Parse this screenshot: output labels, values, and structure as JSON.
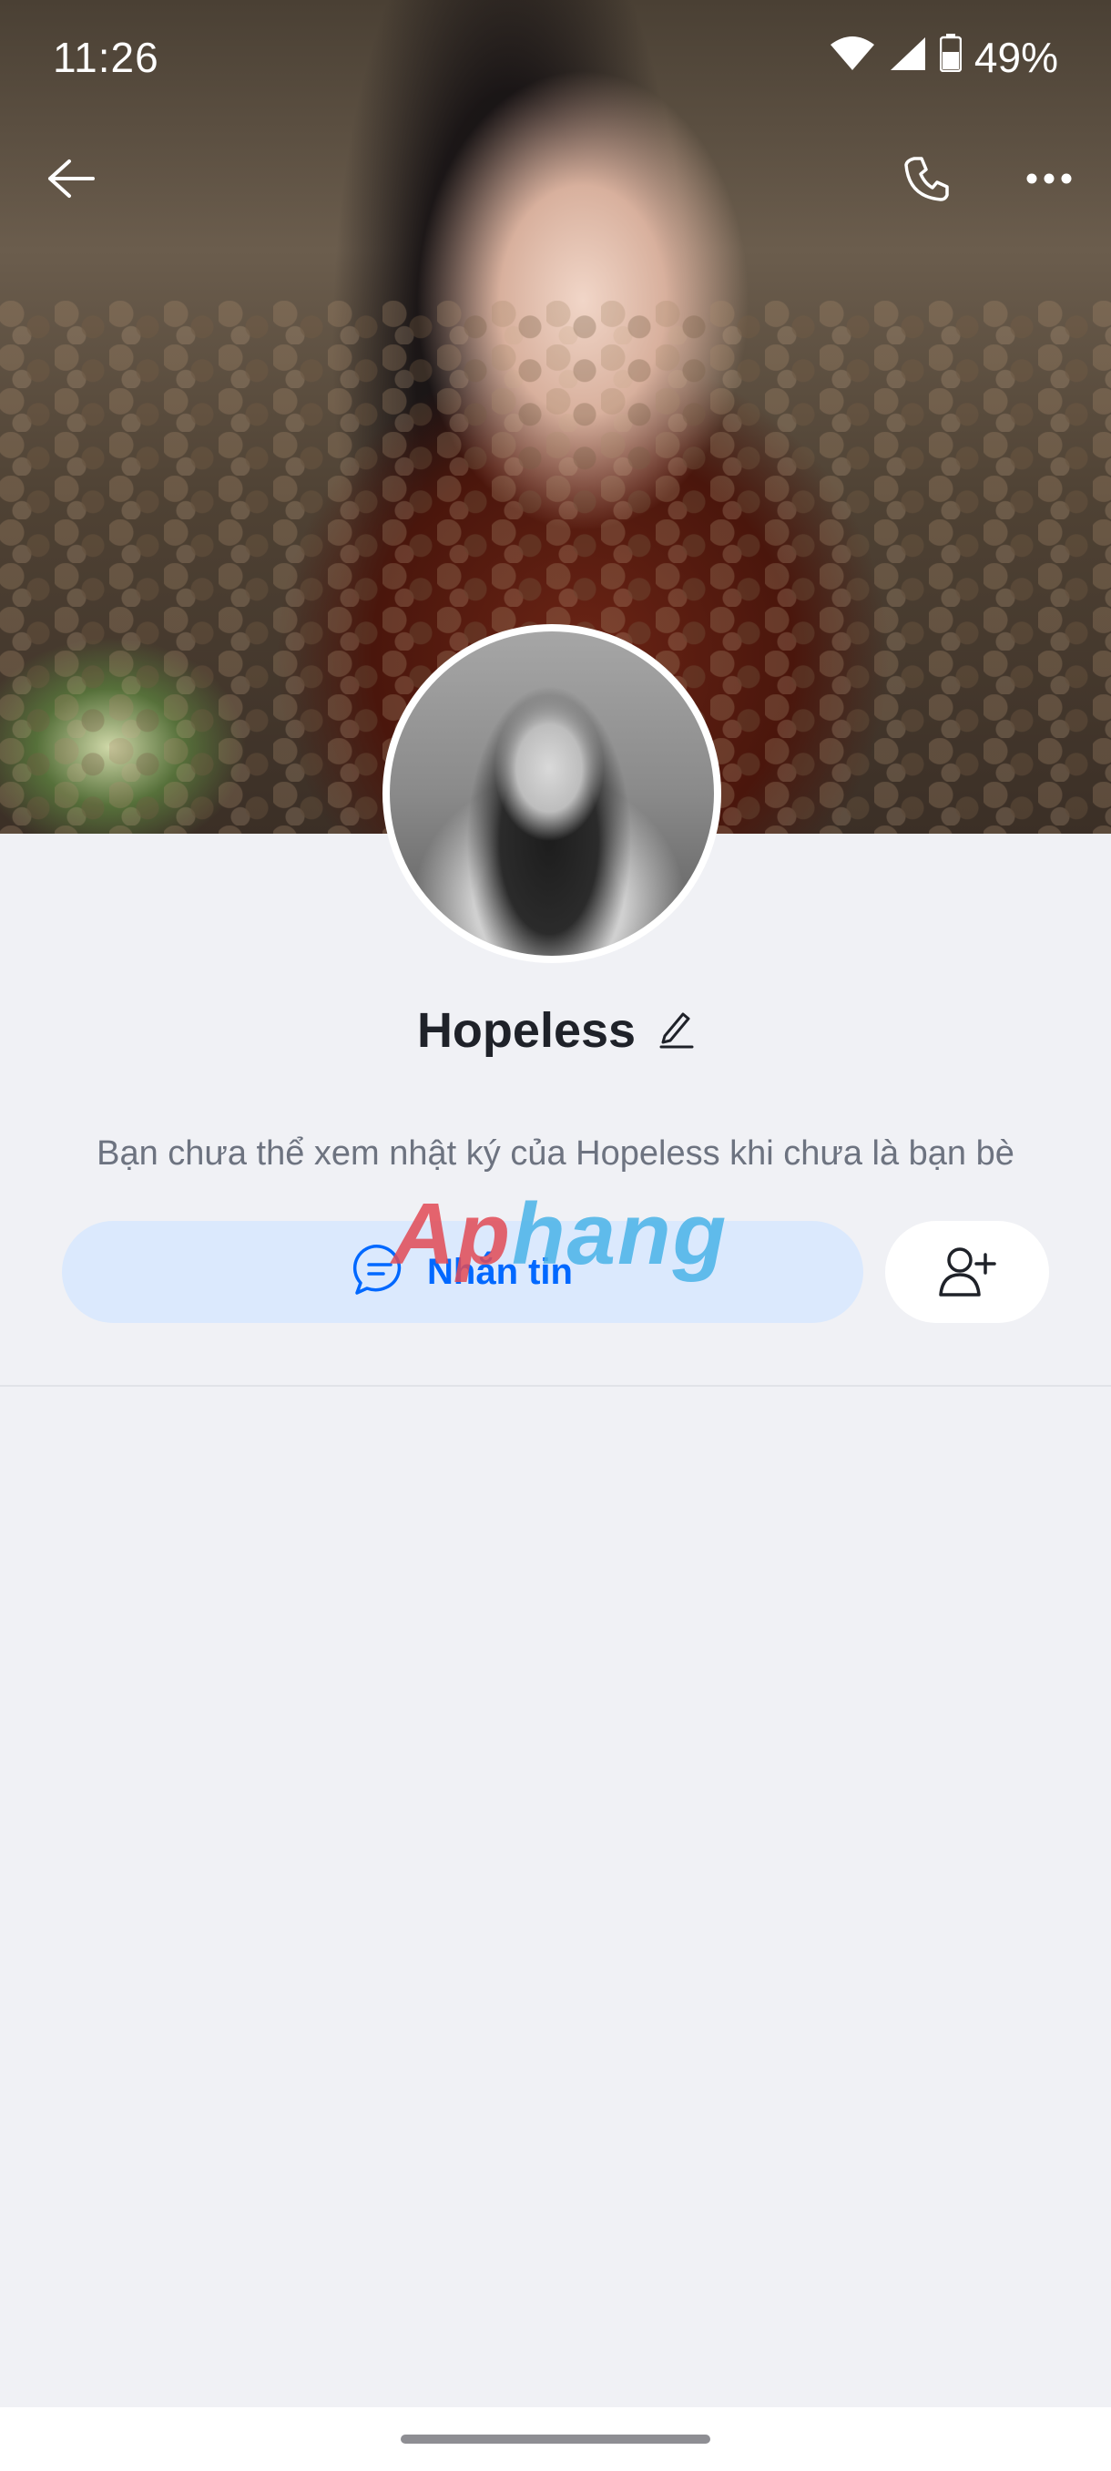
{
  "status_bar": {
    "time": "11:26",
    "battery": "49%"
  },
  "header": {
    "back_icon": "arrow-left-icon",
    "call_icon": "phone-icon",
    "more_icon": "more-horizontal-icon"
  },
  "profile": {
    "name": "Hopeless",
    "edit_icon": "pencil-icon",
    "privacy_note": "Bạn chưa thể xem nhật ký của Hopeless khi chưa là bạn bè"
  },
  "actions": {
    "message_label": "Nhắn tin",
    "message_icon": "chat-bubble-icon",
    "add_friend_icon": "add-user-icon"
  },
  "watermark": {
    "part1": "Ap",
    "part2": "hang"
  },
  "colors": {
    "accent": "#0068ff",
    "message_bg": "#dbe9fd",
    "page_bg": "#f0f1f5"
  }
}
